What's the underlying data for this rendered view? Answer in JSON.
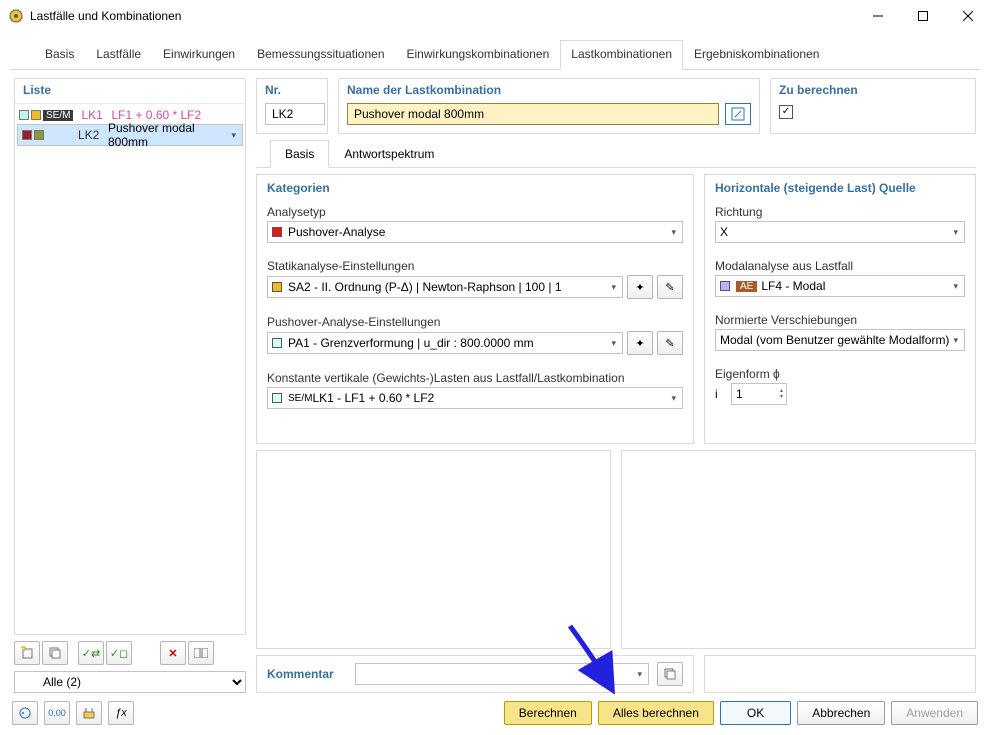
{
  "window": {
    "title": "Lastfälle und Kombinationen"
  },
  "mainTabs": {
    "t0": "Basis",
    "t1": "Lastfälle",
    "t2": "Einwirkungen",
    "t3": "Bemessungssituationen",
    "t4": "Einwirkungskombinationen",
    "t5": "Lastkombinationen",
    "t6": "Ergebniskombinationen"
  },
  "list": {
    "header": "Liste",
    "rows": [
      {
        "badge": "SE/M",
        "lk": "LK1",
        "text": "LF1 + 0.60 * LF2",
        "c1": "#c3f3ef",
        "c2": "#f1b922"
      },
      {
        "badge": "",
        "lk": "LK2",
        "text": "Pushover modal 800mm",
        "c1": "#9a1d2d",
        "c2": "#8b9a34"
      }
    ],
    "filter": "Alle (2)"
  },
  "nr": {
    "header": "Nr.",
    "value": "LK2"
  },
  "name": {
    "header": "Name der Lastkombination",
    "value": "Pushover modal 800mm"
  },
  "compute": {
    "header": "Zu berechnen",
    "checked": "✓"
  },
  "subTabs": {
    "s0": "Basis",
    "s1": "Antwortspektrum"
  },
  "cat": {
    "header": "Kategorien",
    "analysetype_lbl": "Analysetyp",
    "analysetype_val": "Pushover-Analyse",
    "sa_lbl": "Statikanalyse-Einstellungen",
    "sa_val": "SA2 - II. Ordnung (P-Δ) | Newton-Raphson | 100 | 1",
    "po_lbl": "Pushover-Analyse-Einstellungen",
    "po_val": "PA1 - Grenzverformung | u_dir : 800.0000 mm",
    "kv_lbl": "Konstante vertikale (Gewichts-)Lasten aus Lastfall/Lastkombination",
    "kv_badge": "SE/M",
    "kv_val": "LK1 - LF1 + 0.60 * LF2"
  },
  "horz": {
    "header": "Horizontale (steigende Last) Quelle",
    "dir_lbl": "Richtung",
    "dir_val": "X",
    "modal_lbl": "Modalanalyse aus Lastfall",
    "modal_badge": "AE",
    "modal_val": "LF4 - Modal",
    "norm_lbl": "Normierte Verschiebungen",
    "norm_val": "Modal (vom Benutzer gewählte Modalform)",
    "eig_lbl": "Eigenform ϕ",
    "eig_i": "i",
    "eig_val": "1"
  },
  "kommentar_lbl": "Kommentar",
  "buttons": {
    "berechnen": "Berechnen",
    "alles": "Alles berechnen",
    "ok": "OK",
    "cancel": "Abbrechen",
    "apply": "Anwenden"
  }
}
